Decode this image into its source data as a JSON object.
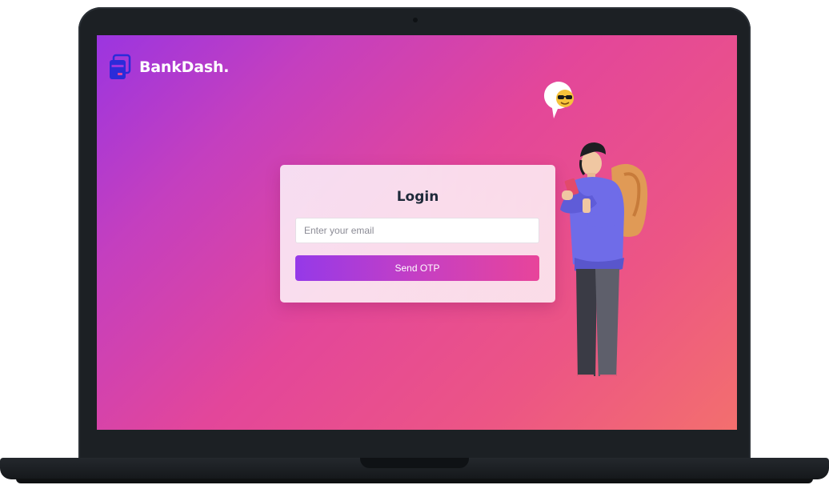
{
  "brand": {
    "name": "BankDash.",
    "logo_icon": "stacked-cards-icon",
    "logo_color": "#2b2bd9"
  },
  "login": {
    "title": "Login",
    "email_placeholder": "Enter your email",
    "email_value": "",
    "submit_label": "Send OTP"
  },
  "illustration": {
    "subject": "person-with-backpack-holding-phone",
    "bubble_icon": "sunglasses-emoji-icon"
  },
  "colors": {
    "gradient_start": "#9b35e0",
    "gradient_mid": "#e3469a",
    "gradient_end": "#f36f6e",
    "button_start": "#9539e8",
    "button_end": "#e8449a",
    "device_frame": "#1c2024"
  }
}
